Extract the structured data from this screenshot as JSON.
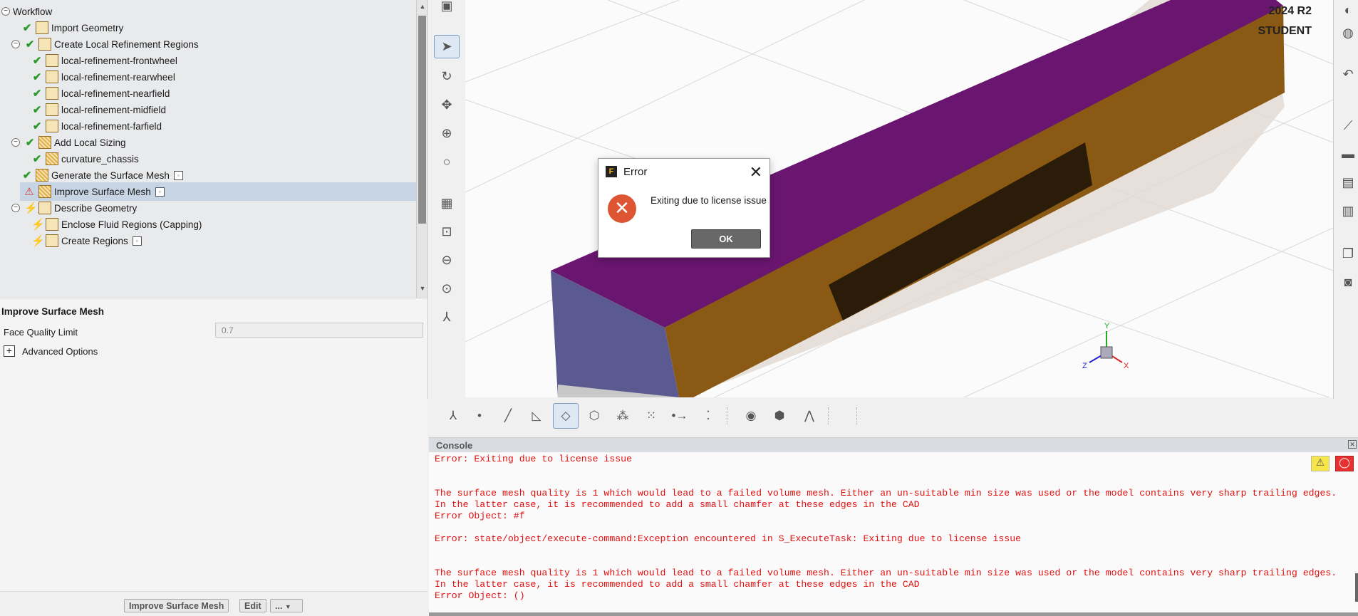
{
  "tree": {
    "root": "Workflow",
    "items": [
      {
        "label": "Import Geometry",
        "status": "done",
        "icon": "import-geometry-icon",
        "save": false
      },
      {
        "label": "Create Local Refinement Regions",
        "status": "done",
        "icon": "refinement-region-icon",
        "save": false
      },
      {
        "label": "local-refinement-frontwheel",
        "status": "done",
        "icon": "refinement-region-icon",
        "save": false
      },
      {
        "label": "local-refinement-rearwheel",
        "status": "done",
        "icon": "refinement-region-icon",
        "save": false
      },
      {
        "label": "local-refinement-nearfield",
        "status": "done",
        "icon": "refinement-region-icon",
        "save": false
      },
      {
        "label": "local-refinement-midfield",
        "status": "done",
        "icon": "refinement-region-icon",
        "save": false
      },
      {
        "label": "local-refinement-farfield",
        "status": "done",
        "icon": "refinement-region-icon",
        "save": false
      },
      {
        "label": "Add Local Sizing",
        "status": "done",
        "icon": "sizing-icon",
        "save": false
      },
      {
        "label": "curvature_chassis",
        "status": "done",
        "icon": "sizing-icon",
        "save": false
      },
      {
        "label": "Generate the Surface Mesh",
        "status": "done",
        "icon": "surface-mesh-icon",
        "save": true
      },
      {
        "label": "Improve Surface Mesh",
        "status": "warning",
        "icon": "surface-mesh-icon",
        "save": true
      },
      {
        "label": "Describe Geometry",
        "status": "pending",
        "icon": "describe-geometry-icon",
        "save": false
      },
      {
        "label": "Enclose Fluid Regions (Capping)",
        "status": "pending",
        "icon": "capping-icon",
        "save": false
      },
      {
        "label": "Create Regions",
        "status": "pending",
        "icon": "regions-icon",
        "save": true
      }
    ]
  },
  "props": {
    "title": "Improve Surface Mesh",
    "face_quality_label": "Face Quality Limit",
    "face_quality_value": "0.7",
    "advanced_label": "Advanced Options"
  },
  "bottom": {
    "task_button": "Improve Surface Mesh",
    "edit_button": "Edit",
    "more_button": "..."
  },
  "viewport": {
    "version": "2024 R2",
    "edition": "STUDENT"
  },
  "dialog": {
    "title": "Error",
    "message": "Exiting due to license issue",
    "ok_label": "OK"
  },
  "console": {
    "title": "Console",
    "lines": [
      "Error: Exiting due to license issue",
      "",
      "",
      "The surface mesh quality is 1 which would lead to a failed volume mesh. Either an un-suitable min size was used or the model contains very sharp trailing edges.",
      "In the latter case, it is recommended to add a small chamfer at these edges in the CAD",
      "Error Object: #f",
      "",
      "Error: state/object/execute-command:Exception encountered in S_ExecuteTask: Exiting due to license issue",
      "",
      "",
      "The surface mesh quality is 1 which would lead to a failed volume mesh. Either an un-suitable min size was used or the model contains very sharp trailing edges.",
      "In the latter case, it is recommended to add a small chamfer at these edges in the CAD",
      "Error Object: ()"
    ]
  },
  "colors": {
    "mesh_top": "#6a1670",
    "mesh_side": "#8a5a14",
    "mesh_end": "#5a5a90",
    "error": "#e01010",
    "selected_row": "#c7d4e4"
  }
}
